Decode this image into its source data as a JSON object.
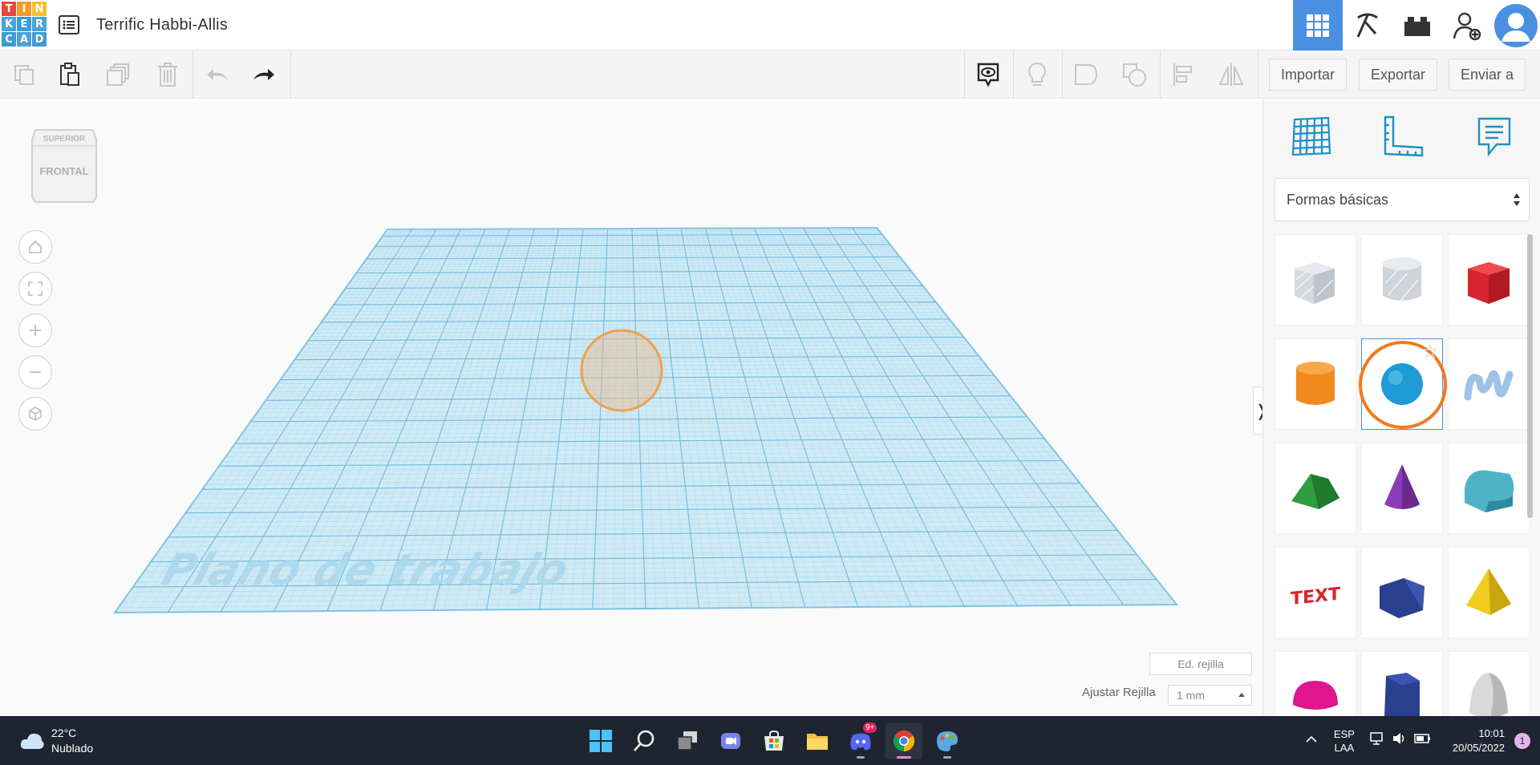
{
  "app": {
    "logo_letters": [
      "T",
      "I",
      "N",
      "K",
      "E",
      "R",
      "C",
      "A",
      "D"
    ],
    "logo_colors": [
      "#e8473b",
      "#f59b27",
      "#f6c02c",
      "#4aa3d9",
      "#3f9bd3",
      "#4aa3d9",
      "#3f9bd3",
      "#4aa3d9",
      "#3f9bd3"
    ],
    "title": "Terrific Habbi-Allis"
  },
  "header": {
    "view_buttons": [
      "3d-design-view-icon",
      "codeblocks-pickaxe-icon",
      "bricks-icon",
      "add-user-icon"
    ],
    "accent": "#4a90e2"
  },
  "toolbar": {
    "copy": "copy-icon",
    "paste": "paste-icon",
    "duplicate": "duplicate-icon",
    "delete": "trash-icon",
    "undo": "undo-icon",
    "redo": "redo-icon",
    "import_label": "Importar",
    "export_label": "Exportar",
    "send_label": "Enviar a"
  },
  "canvas": {
    "view_cube_top": "SUPERIOR",
    "view_cube_front": "FRONTAL",
    "workplane_label": "Plano de trabajo",
    "edit_grid_label": "Ed. rejilla",
    "snap_grid_label": "Ajustar Rejilla",
    "snap_grid_value": "1 mm",
    "collapse_glyph": "❭"
  },
  "panel": {
    "tabs": [
      "workplane-grid-icon",
      "ruler-icon",
      "notes-icon"
    ],
    "category": "Formas básicas",
    "shapes": [
      {
        "name": "box-hole",
        "color": "#c9ced6"
      },
      {
        "name": "cylinder-hole",
        "color": "#c9ced6"
      },
      {
        "name": "box",
        "color": "#d7242e"
      },
      {
        "name": "cylinder",
        "color": "#f08a1c"
      },
      {
        "name": "sphere",
        "color": "#1e9bd7"
      },
      {
        "name": "scribble",
        "color": "#9cc3e6"
      },
      {
        "name": "roof",
        "color": "#2e9e3f"
      },
      {
        "name": "cone",
        "color": "#8a3db4"
      },
      {
        "name": "round-roof",
        "color": "#4fb3c8"
      },
      {
        "name": "text",
        "color": "#d7242e"
      },
      {
        "name": "wedge",
        "color": "#2a3f8f"
      },
      {
        "name": "pyramid",
        "color": "#f2cc1d"
      },
      {
        "name": "half-sphere",
        "color": "#e0168f"
      },
      {
        "name": "polygon",
        "color": "#2a3f8f"
      },
      {
        "name": "paraboloid",
        "color": "#d9d9d9"
      }
    ],
    "text_shape_label": "TEXT"
  },
  "taskbar": {
    "temperature": "22°C",
    "weather": "Nublado",
    "apps": [
      "windows-start-icon",
      "search-icon",
      "task-view-icon",
      "teams-chat-icon",
      "microsoft-store-icon",
      "file-explorer-icon",
      "discord-icon",
      "chrome-icon",
      "paint-icon"
    ],
    "discord_badge": "9+",
    "lang_top": "ESP",
    "lang_bottom": "LAA",
    "time": "10:01",
    "date": "20/05/2022",
    "notifications": "1"
  }
}
